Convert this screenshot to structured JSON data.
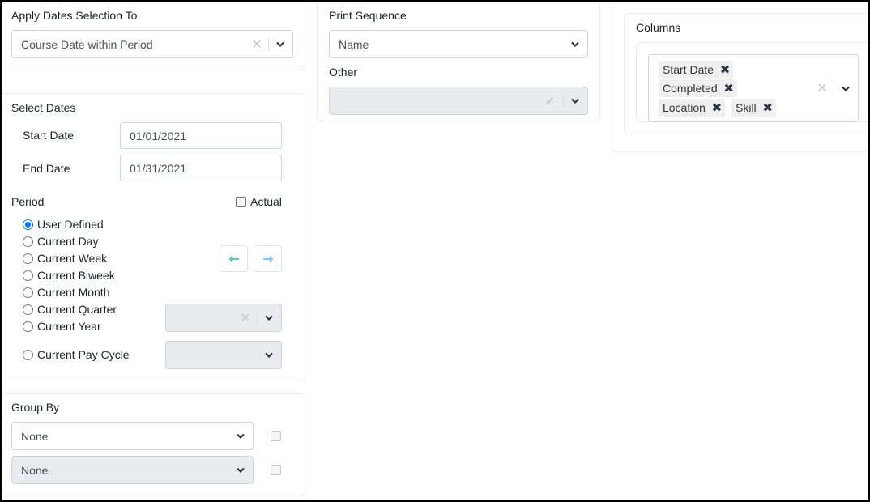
{
  "apply_dates": {
    "label": "Apply Dates Selection To",
    "value": "Course Date within Period",
    "clear_icon": "✕"
  },
  "select_dates": {
    "label": "Select Dates",
    "start_date": {
      "label": "Start Date",
      "value": "01/01/2021"
    },
    "end_date": {
      "label": "End Date",
      "value": "01/31/2021"
    },
    "period_label": "Period",
    "actual_label": "Actual",
    "actual_checked": false,
    "period_options": [
      {
        "label": "User Defined",
        "checked": true
      },
      {
        "label": "Current Day",
        "checked": false
      },
      {
        "label": "Current Week",
        "checked": false
      },
      {
        "label": "Current Biweek",
        "checked": false
      },
      {
        "label": "Current Month",
        "checked": false
      },
      {
        "label": "Current Quarter",
        "checked": false
      },
      {
        "label": "Current Year",
        "checked": false
      },
      {
        "label": "Current Pay Cycle",
        "checked": false
      }
    ],
    "prev_icon": "←",
    "next_icon": "→",
    "quarter_year_select": {
      "value": "",
      "clear_icon": "✕"
    },
    "pay_cycle_select": {
      "value": ""
    },
    "colors": {
      "prev_arrow": "#5cc5b3",
      "next_arrow": "#7ec4f2"
    }
  },
  "group_by": {
    "label": "Group By",
    "first": {
      "value": "None",
      "checked": false
    },
    "second": {
      "value": "None",
      "checked": false
    }
  },
  "print_sequence": {
    "label": "Print Sequence",
    "value": "Name",
    "other_label": "Other",
    "other_value": "",
    "other_icon": "✔"
  },
  "columns": {
    "label": "Columns",
    "tags": [
      "Start Date",
      "Completed",
      "Location",
      "Skill"
    ],
    "tag_remove_icon": "✖",
    "clear_icon": "✕"
  }
}
